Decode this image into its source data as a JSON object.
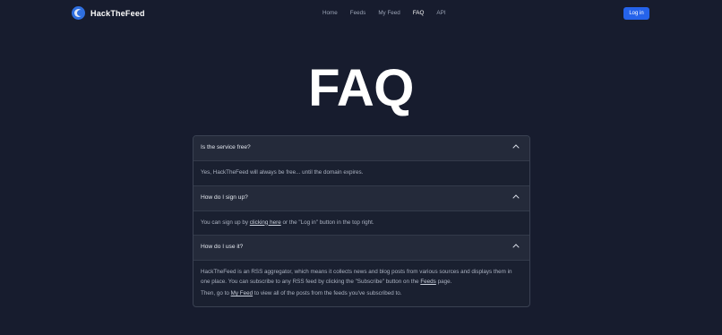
{
  "brand": {
    "name": "HackTheFeed"
  },
  "nav": {
    "home": "Home",
    "feeds": "Feeds",
    "my_feed": "My Feed",
    "faq": "FAQ",
    "api": "API",
    "login": "Log in"
  },
  "page": {
    "title": "FAQ"
  },
  "faq": [
    {
      "question": "Is the service free?",
      "answer_1": "Yes, HackTheFeed will always be free... until the domain expires."
    },
    {
      "question": "How do I sign up?",
      "answer_pre": "You can sign up by ",
      "answer_link": "clicking here",
      "answer_post": " or the \"Log in\" button in the top right."
    },
    {
      "question": "How do I use it?",
      "answer_pre": "HackTheFeed is an RSS aggregator, which means it collects news and blog posts from various sources and displays them in one place. You can subscribe to any RSS feed by clicking the \"Subscribe\" button on the ",
      "answer_link": "Feeds",
      "answer_post": " page.",
      "answer2_pre": "Then, go to ",
      "answer2_link": "My Feed",
      "answer2_post": " to view all of the posts from the feeds you've subscribed to."
    }
  ],
  "colors": {
    "background": "#171c2e",
    "accent": "#2563eb"
  },
  "icons": {
    "logo": "hackthefeed-logo-icon",
    "chevron": "chevron-up-icon"
  }
}
